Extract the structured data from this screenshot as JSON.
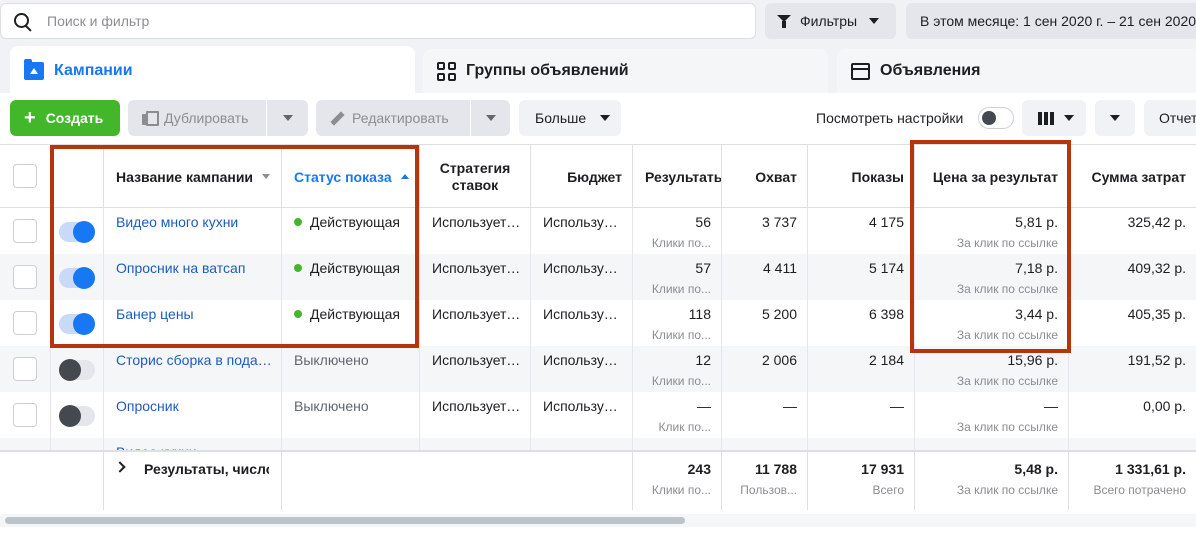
{
  "search": {
    "placeholder": "Поиск и фильтр"
  },
  "filters": {
    "label": "Фильтры"
  },
  "date_range": {
    "label": "В этом месяце: 1 сен 2020 г. – 21 сен 2020"
  },
  "tabs": [
    {
      "label": "Кампании"
    },
    {
      "label": "Группы объявлений"
    },
    {
      "label": "Объявления"
    }
  ],
  "toolbar": {
    "create_label": "Создать",
    "duplicate_label": "Дублировать",
    "edit_label": "Редактировать",
    "more_label": "Больше",
    "view_settings_label": "Посмотреть настройки",
    "reports_label": "Отчет"
  },
  "columns": {
    "name": "Название кампании",
    "status": "Статус показа",
    "strategy": "Стратегия ставок",
    "budget": "Бюджет",
    "results": "Результаты",
    "reach": "Охват",
    "impressions": "Показы",
    "cost_per_result": "Цена за результат",
    "spend": "Сумма затрат"
  },
  "rows": [
    {
      "name": "Видео много кухни",
      "on": true,
      "status": "Действующая",
      "strategy": "Используется...",
      "budget": "Используется...",
      "results": "56",
      "results_sub": "Клики по...",
      "reach": "3 737",
      "impressions": "4 175",
      "cpr": "5,81 р.",
      "cpr_sub": "За клик по ссылке",
      "spend": "325,42 р."
    },
    {
      "name": "Опросник на ватсап",
      "on": true,
      "status": "Действующая",
      "strategy": "Используется...",
      "budget": "Используется...",
      "results": "57",
      "results_sub": "Клики по...",
      "reach": "4 411",
      "impressions": "5 174",
      "cpr": "7,18 р.",
      "cpr_sub": "За клик по ссылке",
      "spend": "409,32 р."
    },
    {
      "name": "Банер цены",
      "on": true,
      "status": "Действующая",
      "strategy": "Используется...",
      "budget": "Используется...",
      "results": "118",
      "results_sub": "Клики по...",
      "reach": "5 200",
      "impressions": "6 398",
      "cpr": "3,44 р.",
      "cpr_sub": "За клик по ссылке",
      "spend": "405,35 р."
    },
    {
      "name": "Сторис сборка в подарок",
      "on": false,
      "status": "Выключено",
      "strategy": "Используется...",
      "budget": "Используется...",
      "results": "12",
      "results_sub": "Клики по...",
      "reach": "2 006",
      "impressions": "2 184",
      "cpr": "15,96 р.",
      "cpr_sub": "За клик по ссылке",
      "spend": "191,52 р."
    },
    {
      "name": "Опросник",
      "on": false,
      "status": "Выключено",
      "strategy": "Используется...",
      "budget": "Используется...",
      "results": "—",
      "results_sub": "Клик по...",
      "reach": "—",
      "impressions": "—",
      "cpr": "—",
      "cpr_sub": "За клик по ссылке",
      "spend": "0,00 р."
    }
  ],
  "partial_row": {
    "name": "Видео кухни"
  },
  "totals": {
    "label": "Результаты, число кампаний",
    "results": "243",
    "results_sub": "Клики по...",
    "reach": "11 788",
    "reach_sub": "Пользов...",
    "impressions": "17 931",
    "impressions_sub": "Всего",
    "cpr": "5,48 р.",
    "cpr_sub": "За клик по ссылке",
    "spend": "1 331,61 р.",
    "spend_sub": "Всего потрачено"
  },
  "colors": {
    "accent": "#1877f2",
    "create": "#42b72a",
    "highlight": "#b5360c",
    "active_dot": "#42b72a"
  }
}
